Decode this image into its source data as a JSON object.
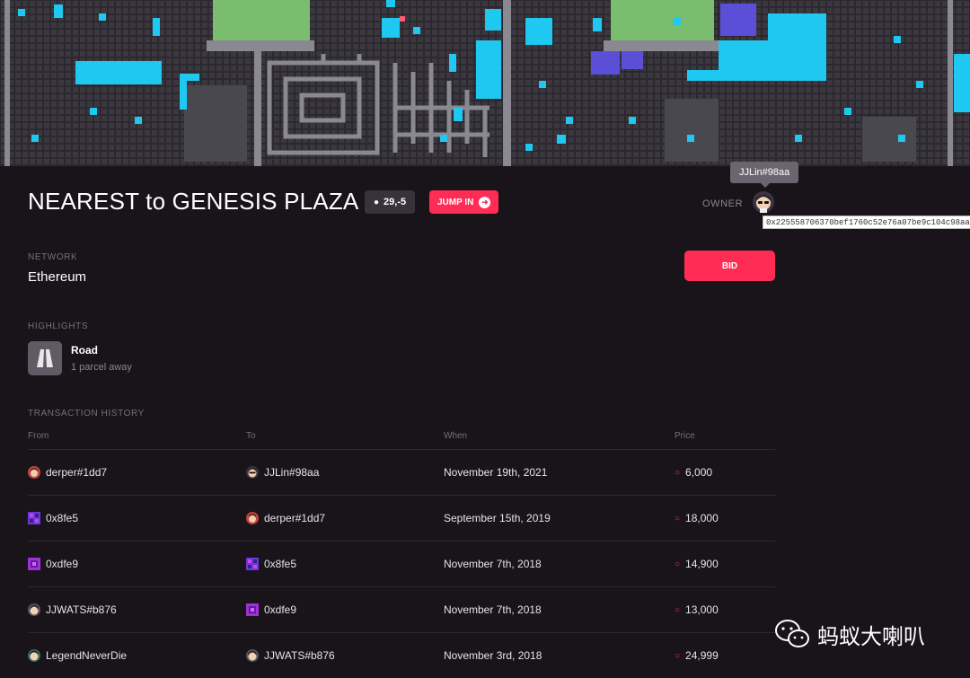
{
  "parcel": {
    "title": "NEAREST to GENESIS PLAZA",
    "coords": "29,-5",
    "jump_label": "JUMP IN"
  },
  "owner": {
    "label": "OWNER",
    "name": "JJLin#98aa",
    "address": "0x225558706370bef1760c52e76a07be9c104c98aa"
  },
  "network": {
    "label": "NETWORK",
    "value": "Ethereum"
  },
  "bid_label": "BID",
  "highlights": {
    "label": "HIGHLIGHTS",
    "items": [
      {
        "title": "Road",
        "subtitle": "1 parcel away",
        "icon": "road-icon"
      }
    ]
  },
  "history": {
    "label": "TRANSACTION HISTORY",
    "columns": [
      "From",
      "To",
      "When",
      "Price"
    ],
    "rows": [
      {
        "from": "derper#1dd7",
        "to": "JJLin#98aa",
        "when": "November 19th, 2021",
        "price": "6,000"
      },
      {
        "from": "0x8fe5",
        "to": "derper#1dd7",
        "when": "September 15th, 2019",
        "price": "18,000"
      },
      {
        "from": "0xdfe9",
        "to": "0x8fe5",
        "when": "November 7th, 2018",
        "price": "14,900"
      },
      {
        "from": "JJWATS#b876",
        "to": "0xdfe9",
        "when": "November 7th, 2018",
        "price": "13,000"
      },
      {
        "from": "LegendNeverDie",
        "to": "JJWATS#b876",
        "when": "November 3rd, 2018",
        "price": "24,999"
      }
    ]
  },
  "watermark": "蚂蚁大喇叭",
  "colors": {
    "accent": "#ff2d55",
    "background": "#18141a",
    "map_cyan": "#1fc8f0",
    "map_green": "#7bbd6e",
    "map_purple": "#5a4fd6"
  }
}
